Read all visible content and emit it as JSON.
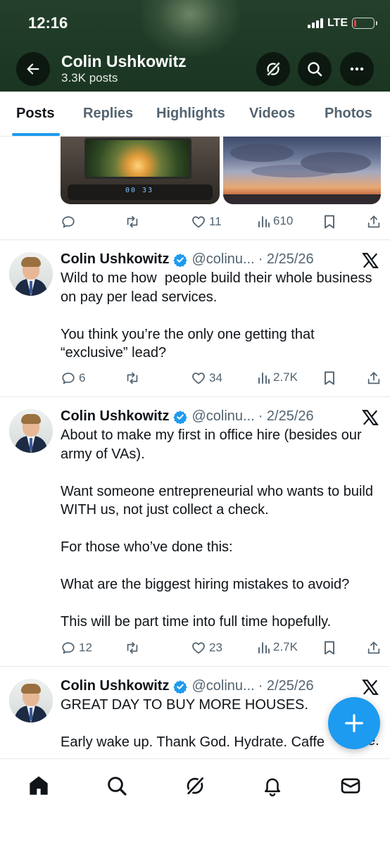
{
  "status_bar": {
    "time": "12:16",
    "network": "LTE",
    "battery_level": 0.1
  },
  "header": {
    "name": "Colin Ushkowitz",
    "posts": "3.3K posts",
    "icons": {
      "back": "arrow-left-icon",
      "grok": "grok-icon",
      "search": "search-icon",
      "more": "more-icon"
    }
  },
  "tabs": [
    {
      "label": "Posts",
      "active": true
    },
    {
      "label": "Replies"
    },
    {
      "label": "Highlights"
    },
    {
      "label": "Videos"
    },
    {
      "label": "Photos"
    }
  ],
  "partial_post": {
    "replies": "",
    "reposts": "",
    "likes": "11",
    "views": "610"
  },
  "tweets": [
    {
      "name": "Colin Ushkowitz",
      "handle": "@colinu...",
      "date": "· 2/25/26",
      "text": "Wild to me how  people build their whole business on pay per lead services.\n\nYou think you’re the only one getting that “exclusive” lead?",
      "replies": "6",
      "reposts": "",
      "likes": "34",
      "views": "2.7K"
    },
    {
      "name": "Colin Ushkowitz",
      "handle": "@colinu...",
      "date": "· 2/25/26",
      "text": "About to make my first in office hire (besides our army of VAs).\n\nWant someone entrepreneurial who wants to build WITH us, not just collect a check.\n\nFor those who’ve done this:\n\nWhat are the biggest hiring mistakes to avoid?\n\nThis will be part time into full time hopefully.",
      "replies": "12",
      "reposts": "",
      "likes": "23",
      "views": "2.7K"
    },
    {
      "name": "Colin Ushkowitz",
      "handle": "@colinu...",
      "date": "· 2/25/26",
      "text": "GREAT DAY TO BUY MORE HOUSES.\n\nEarly wake up. Thank God. Hydrate. Caffe",
      "text_trailing": "e."
    }
  ],
  "bottom_nav": [
    {
      "icon": "home-icon",
      "active": true
    },
    {
      "icon": "search-icon"
    },
    {
      "icon": "grok-icon"
    },
    {
      "icon": "bell-icon"
    },
    {
      "icon": "mail-icon"
    }
  ],
  "colors": {
    "accent": "#1d9bf0",
    "header_bg": "#1e3a26",
    "text": "#0f1419",
    "muted": "#536471",
    "verified": "#1d9bf0"
  }
}
